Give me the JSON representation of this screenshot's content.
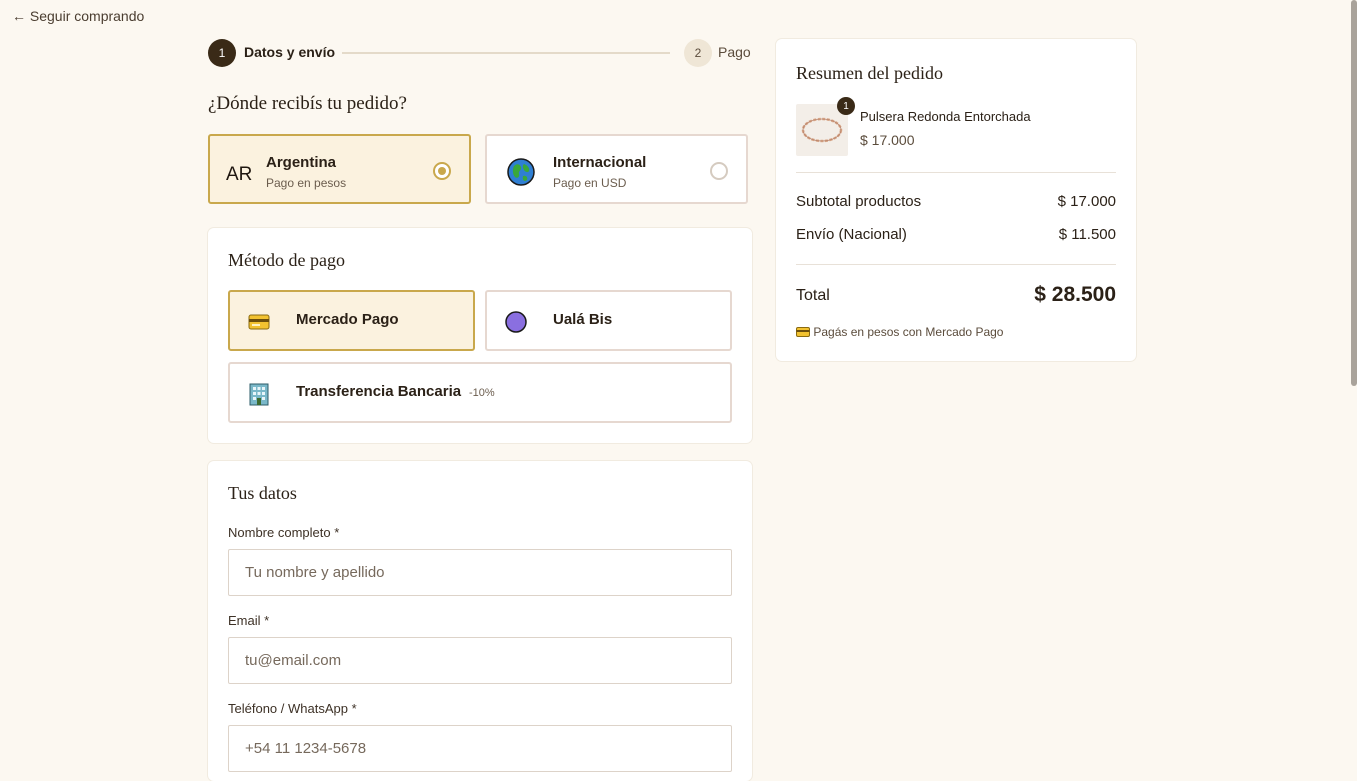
{
  "nav": {
    "back_label": "← Seguir comprando"
  },
  "stepper": {
    "steps": [
      {
        "number": "1",
        "label": "Datos y envío",
        "state": "active"
      },
      {
        "number": "2",
        "label": "Pago",
        "state": "pending"
      }
    ]
  },
  "destination": {
    "title": "¿Dónde recibís tu pedido?",
    "options": [
      {
        "code": "AR",
        "title": "Argentina",
        "subtitle": "Pago en pesos",
        "selected": true
      },
      {
        "icon": "globe-icon",
        "title": "Internacional",
        "subtitle": "Pago en USD",
        "selected": false
      }
    ]
  },
  "payment": {
    "title": "Método de pago",
    "methods": [
      {
        "icon": "credit-card-icon",
        "label": "Mercado Pago",
        "selected": true
      },
      {
        "icon": "purple-circle-icon",
        "label": "Ualá Bis",
        "selected": false
      },
      {
        "icon": "bank-building-icon",
        "label": "Transferencia Bancaria",
        "badge": "-10%",
        "selected": false
      }
    ]
  },
  "form": {
    "title": "Tus datos",
    "fields": [
      {
        "label": "Nombre completo *",
        "placeholder": "Tu nombre y apellido",
        "value": ""
      },
      {
        "label": "Email *",
        "placeholder": "tu@email.com",
        "value": ""
      },
      {
        "label": "Teléfono / WhatsApp *",
        "placeholder": "+54 11 1234-5678",
        "value": ""
      }
    ]
  },
  "summary": {
    "title": "Resumen del pedido",
    "item": {
      "quantity": "1",
      "name": "Pulsera Redonda Entorchada",
      "price": "$ 17.000"
    },
    "subtotal_label": "Subtotal productos",
    "subtotal_value": "$ 17.000",
    "shipping_label": "Envío (Nacional)",
    "shipping_value": "$ 11.500",
    "total_label": "Total",
    "total_value": "$ 28.500",
    "note": "Pagás en pesos con Mercado Pago"
  },
  "colors": {
    "accent": "#c9a84c",
    "dark": "#3a2a17",
    "background": "#fcf8f1"
  }
}
